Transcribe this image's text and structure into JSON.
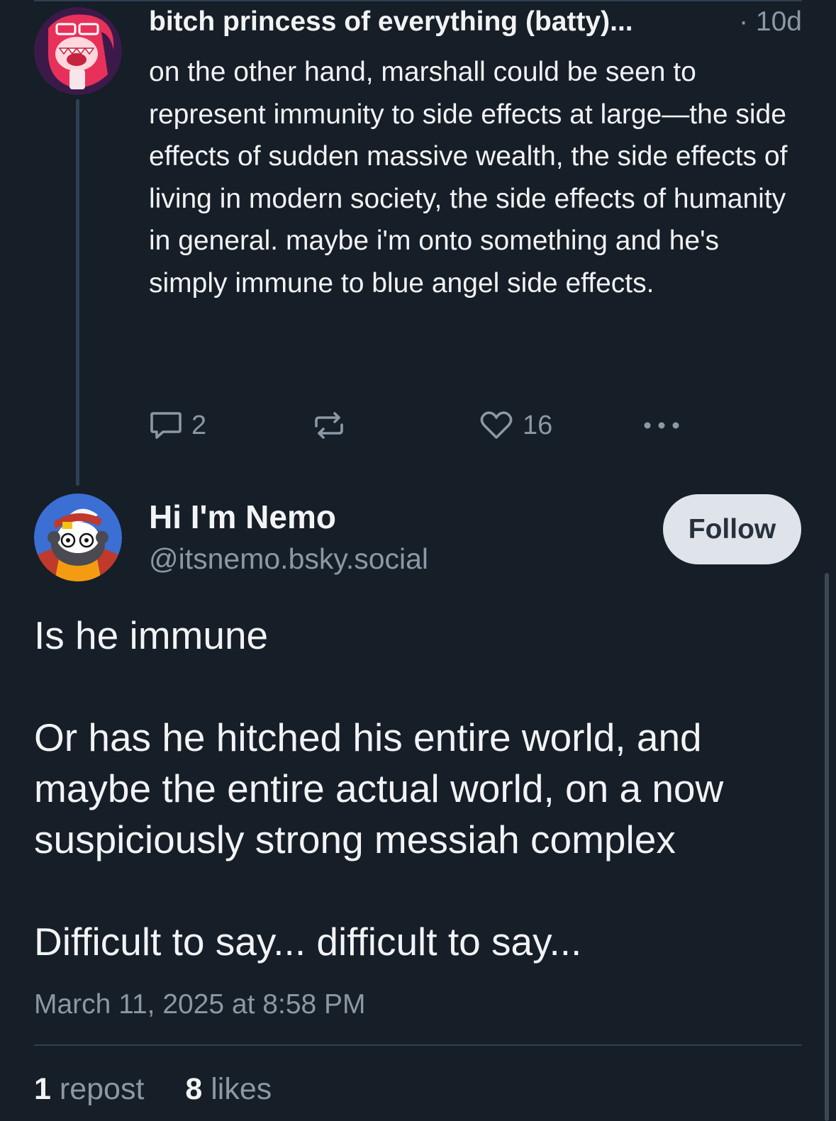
{
  "parent_post": {
    "author": "bitch princess of everything (batty)...",
    "age": "· 10d",
    "text": "on the other hand, marshall could be seen to represent immunity to side effects at large—the side effects of sudden massive wealth, the side effects of living in modern society, the side effects of humanity in general. maybe i'm onto something and he's simply immune to blue angel side effects.",
    "reply_count": "2",
    "like_count": "16"
  },
  "main_post": {
    "author": "Hi I'm Nemo",
    "handle": "@itsnemo.bsky.social",
    "follow_label": "Follow",
    "paragraphs": [
      "Is he immune",
      "Or has he hitched his entire world, and maybe the entire actual world, on a now suspiciously strong messiah complex",
      "Difficult to say... difficult to say..."
    ],
    "timestamp": "March 11, 2025 at 8:58 PM",
    "repost_count": "1",
    "repost_label": "repost",
    "like_count": "8",
    "like_label": "likes"
  },
  "icons": {
    "reply": "speech-bubble-icon",
    "repost": "repost-arrows-icon",
    "like": "heart-icon",
    "more": "ellipsis-icon"
  },
  "colors": {
    "background": "#161e27",
    "text": "#f1f3f5",
    "muted": "#8b98a5",
    "follow_bg": "#dfe4ea",
    "thread_line": "#2e4052"
  }
}
